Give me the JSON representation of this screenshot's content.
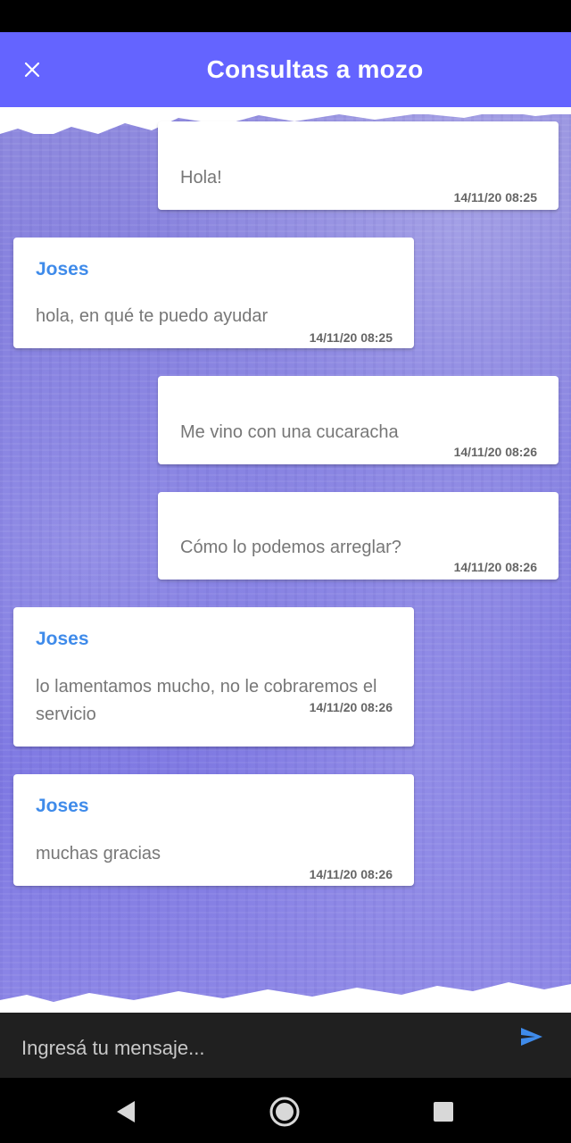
{
  "app_bar": {
    "title": "Consultas a mozo",
    "close_icon": "close-icon",
    "background": "#6464ff"
  },
  "messages": [
    {
      "direction": "outgoing",
      "sender": "",
      "text": "Hola!",
      "time": "14/11/20 08:25"
    },
    {
      "direction": "incoming",
      "sender": "Joses",
      "text": "hola, en qué te puedo ayudar",
      "time": "14/11/20 08:25"
    },
    {
      "direction": "outgoing",
      "sender": "",
      "text": "Me vino con una cucaracha",
      "time": "14/11/20 08:26"
    },
    {
      "direction": "outgoing",
      "sender": "",
      "text": "Cómo lo podemos arreglar?",
      "time": "14/11/20 08:26"
    },
    {
      "direction": "incoming",
      "sender": "Joses",
      "text": "lo lamentamos mucho, no le cobraremos el servicio",
      "time": "14/11/20 08:26"
    },
    {
      "direction": "incoming",
      "sender": "Joses",
      "text": "muchas gracias",
      "time": "14/11/20 08:26"
    }
  ],
  "input": {
    "placeholder": "Ingresá tu mensaje...",
    "value": "",
    "send_icon": "send-icon"
  },
  "nav": {
    "back_icon": "back-icon",
    "home_icon": "home-icon",
    "recents_icon": "recents-icon"
  },
  "colors": {
    "accent": "#6464ff",
    "sender_name": "#3f8bea",
    "send_icon": "#3f8bea"
  }
}
